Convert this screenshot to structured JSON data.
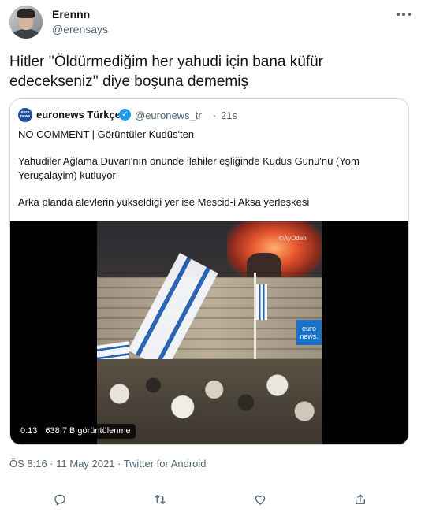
{
  "author": {
    "name": "Erennn",
    "handle": "@erensays"
  },
  "tweet": {
    "text": "Hitler ''Öldürmediğim her yahudi için bana küfür edecekseniz'' diye boşuna dememiş",
    "meta": "ÖS 8:16 · 11 May 2021 · Twitter for Android"
  },
  "quote": {
    "avatar_text": "euro news",
    "name": "euronews Türkçe",
    "verified_icon": "verified-badge-icon",
    "handle": "@euronews_tr",
    "separator": "·",
    "time": "21s",
    "line1": "NO COMMENT | Görüntüler Kudüs'ten",
    "line2": "Yahudiler Ağlama Duvarı'nın önünde ilahiler eşliğinde Kudüs Günü'nü (Yom Yeruşalayim) kutluyor",
    "line3": "Arka planda alevlerin yükseldiği yer ise Mescid-i Aksa yerleşkesi",
    "video": {
      "watermark": "©AyOdeh",
      "logo_text": "euro news.",
      "duration": "0:13",
      "views": "638,7 B görüntülenme"
    }
  },
  "actions": {
    "icons": [
      "reply-icon",
      "retweet-icon",
      "like-icon",
      "share-icon"
    ]
  },
  "colors": {
    "text": "#0f1419",
    "muted": "#536471",
    "border": "#cfd9de",
    "verified": "#1d9bf0"
  }
}
